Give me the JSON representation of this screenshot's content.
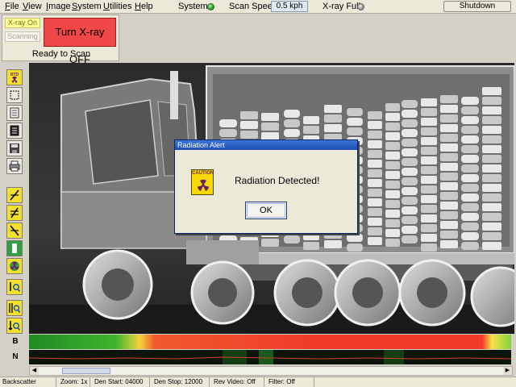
{
  "menu": {
    "items": [
      "File",
      "View",
      "Image",
      "System",
      "Utilities",
      "Help"
    ],
    "system_label": "System:",
    "scan_speed_label": "Scan Speed:",
    "scan_speed_value": "0.5 kph",
    "xray_full_label": "X-ray Full:",
    "shutdown_label": "Shutdown",
    "system_status_color": "#1a8a1a",
    "xray_full_status_color": "#888888"
  },
  "control_panel": {
    "xray_on_label": "X-ray On",
    "scanning_label": "Scanning",
    "turn_off_label": "Turn X-ray OFF",
    "status_text": "Ready to Scan",
    "turn_off_color": "#f04848"
  },
  "toolbar": {
    "tools": [
      "rtd-radiation-icon",
      "crop-icon",
      "report-icon",
      "notes-icon",
      "save-icon",
      "print-icon",
      "threshold-up-icon",
      "threshold-equal-icon",
      "threshold-down-icon",
      "color-map-icon",
      "radiation-overlay-icon",
      "zoom-in-icon",
      "zoom-fit-icon",
      "zoom-out-icon"
    ],
    "rtd_label": "RTD"
  },
  "dialog": {
    "title": "Radiation Alert",
    "icon_label": "CAUTION",
    "message": "Radiation Detected!",
    "ok_label": "OK"
  },
  "tracks": {
    "b_label": "B",
    "n_label": "N"
  },
  "statusbar": {
    "mode": "Backscatter",
    "zoom": "Zoom: 1x",
    "den_start": "Den Start: 04000",
    "den_stop": "Den Stop: 12000",
    "rev_video": "Rev Video: Off",
    "filter": "Filter: Off"
  }
}
